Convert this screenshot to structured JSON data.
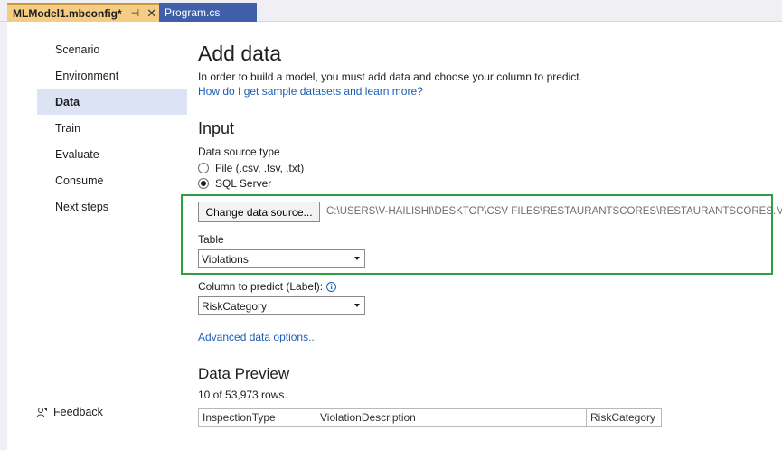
{
  "tabs": [
    {
      "label": "MLModel1.mbconfig*",
      "active": true
    },
    {
      "label": "Program.cs",
      "active": false
    }
  ],
  "sidebar": {
    "items": [
      {
        "label": "Scenario"
      },
      {
        "label": "Environment"
      },
      {
        "label": "Data",
        "active": true
      },
      {
        "label": "Train"
      },
      {
        "label": "Evaluate"
      },
      {
        "label": "Consume"
      },
      {
        "label": "Next steps"
      }
    ],
    "feedback_label": "Feedback"
  },
  "main": {
    "title": "Add data",
    "intro": "In order to build a model, you must add data and choose your column to predict.",
    "intro_link": "How do I get sample datasets and learn more?",
    "input_heading": "Input",
    "data_source_type_label": "Data source type",
    "radio_options": [
      {
        "label": "File (.csv, .tsv, .txt)",
        "checked": false
      },
      {
        "label": "SQL Server",
        "checked": true
      }
    ],
    "change_source_button": "Change data source...",
    "data_source_path": "C:\\USERS\\V-HAILISHI\\DESKTOP\\CSV FILES\\RESTAURANTSCORES\\RESTAURANTSCORES.MDF",
    "table_label": "Table",
    "table_value": "Violations",
    "column_label": "Column to predict (Label):",
    "column_value": "RiskCategory",
    "advanced_link": "Advanced data options...",
    "preview_heading": "Data Preview",
    "rows_text": "10 of 53,973 rows.",
    "preview_columns": [
      "InspectionType",
      "ViolationDescription",
      "RiskCategory"
    ]
  },
  "colors": {
    "active_tab": "#f5cc84",
    "inactive_tab": "#3f5fa8",
    "highlight_box": "#2ea043",
    "link": "#1a5fb4",
    "sidebar_active": "#dce3f5"
  }
}
